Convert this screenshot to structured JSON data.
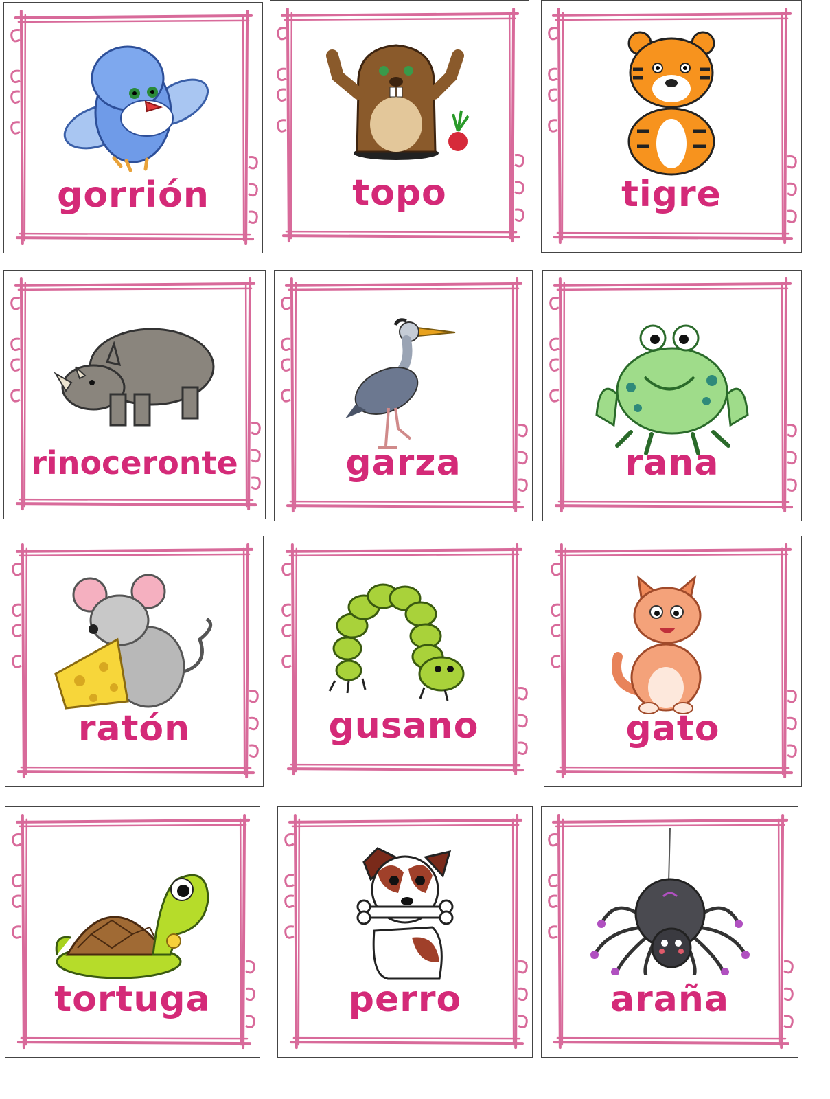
{
  "colors": {
    "label": "#d42a78",
    "frame": "#d86a9a",
    "card_border": "#444444"
  },
  "cards": [
    {
      "word": "gorrión",
      "icon": "sparrow-icon"
    },
    {
      "word": "topo",
      "icon": "mole-icon"
    },
    {
      "word": "tigre",
      "icon": "tiger-icon"
    },
    {
      "word": "rinoceronte",
      "icon": "rhinoceros-icon"
    },
    {
      "word": "garza",
      "icon": "heron-icon"
    },
    {
      "word": "rana",
      "icon": "frog-icon"
    },
    {
      "word": "ratón",
      "icon": "mouse-icon"
    },
    {
      "word": "gusano",
      "icon": "worm-icon"
    },
    {
      "word": "gato",
      "icon": "cat-icon"
    },
    {
      "word": "tortuga",
      "icon": "turtle-icon"
    },
    {
      "word": "perro",
      "icon": "dog-icon"
    },
    {
      "word": "araña",
      "icon": "spider-icon"
    }
  ]
}
